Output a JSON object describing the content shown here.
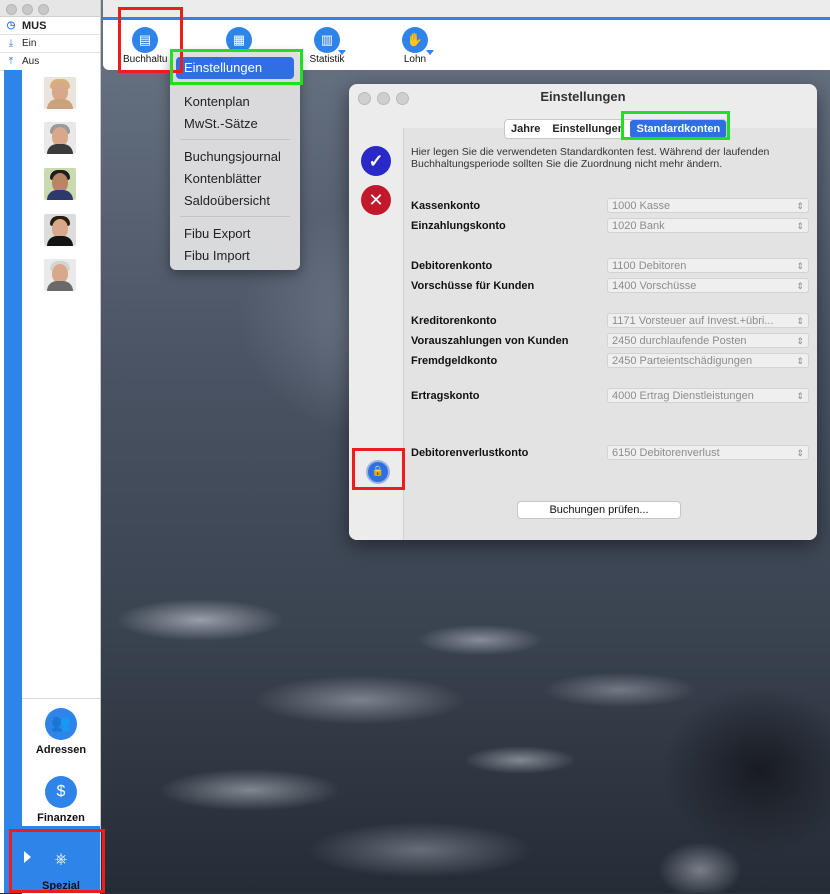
{
  "colors": {
    "accent": "#2f84ea",
    "selection": "#2f6fe3",
    "ok": "#2929c9",
    "cancel": "#c1192b",
    "highlight_red": "#ee1c1c",
    "highlight_green": "#1ee01e"
  },
  "left_window": {
    "title": "MUS",
    "rows": [
      {
        "icon": "clock-icon",
        "label": "MUS"
      },
      {
        "icon": "download-icon",
        "label": "Ein"
      },
      {
        "icon": "upload-icon",
        "label": "Aus"
      }
    ],
    "nav": [
      {
        "icon": "people-icon",
        "label": "Adressen"
      },
      {
        "icon": "coins-icon",
        "label": "Finanzen"
      },
      {
        "icon": "helm-icon",
        "label": "Spezial"
      }
    ]
  },
  "toolbar": {
    "items": [
      {
        "icon": "ledger-icon",
        "label": "Buchhaltu"
      },
      {
        "icon": "calendar-icon",
        "label": ""
      },
      {
        "icon": "bar-chart-icon",
        "label": "Statistik"
      },
      {
        "icon": "money-hand-icon",
        "label": "Lohn"
      }
    ]
  },
  "menu": {
    "selected": "Einstellungen",
    "items": [
      "Kontenplan",
      "MwSt.-Sätze",
      "Buchungsjournal",
      "Kontenblätter",
      "Saldoübersicht",
      "Fibu Export",
      "Fibu Import"
    ]
  },
  "dialog": {
    "title": "Einstellungen",
    "tabs": [
      "Jahre",
      "Einstellungen",
      "Standardkonten"
    ],
    "active_tab": "Standardkonten",
    "description": "Hier legen Sie die verwendeten Standardkonten fest. Während der laufenden Buchhaltungsperiode sollten Sie die Zuordnung nicht mehr ändern.",
    "fields": [
      {
        "label": "Kassenkonto",
        "value": "1000 Kasse"
      },
      {
        "label": "Einzahlungskonto",
        "value": "1020 Bank"
      },
      {
        "label": "Debitorenkonto",
        "value": "1100 Debitoren"
      },
      {
        "label": "Vorschüsse für Kunden",
        "value": "1400 Vorschüsse"
      },
      {
        "label": "Kreditorenkonto",
        "value": "1171 Vorsteuer auf Invest.+übri..."
      },
      {
        "label": "Vorauszahlungen von Kunden",
        "value": "2450 durchlaufende Posten"
      },
      {
        "label": "Fremdgeldkonto",
        "value": "2450 Parteientschädigungen"
      },
      {
        "label": "Ertragskonto",
        "value": "4000 Ertrag Dienstleistungen"
      },
      {
        "label": "Debitorenverlustkonto",
        "value": "6150 Debitorenverlust"
      }
    ],
    "check_button": "Buchungen prüfen..."
  }
}
